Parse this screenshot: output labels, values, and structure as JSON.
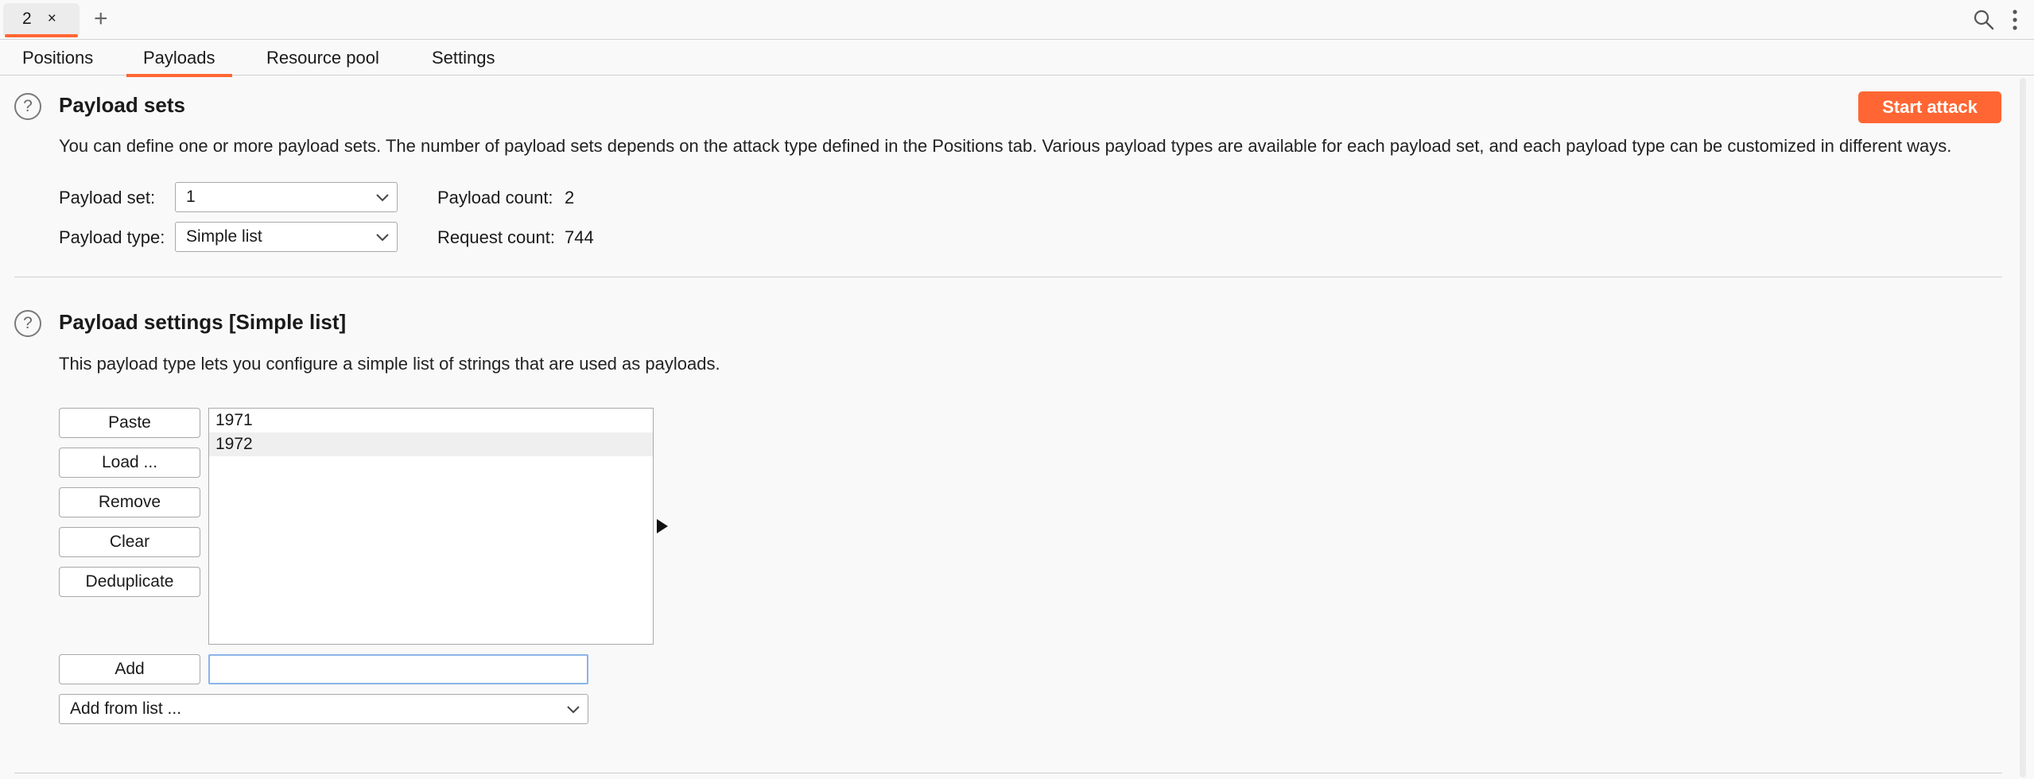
{
  "tab": {
    "label": "2",
    "close": "×",
    "new_tab": "+"
  },
  "subtabs": [
    "Positions",
    "Payloads",
    "Resource pool",
    "Settings"
  ],
  "accent_color": "#ff6633",
  "payload_sets": {
    "title": "Payload sets",
    "help": "?",
    "start_attack": "Start attack",
    "description": "You can define one or more payload sets. The number of payload sets depends on the attack type defined in the Positions tab. Various payload types are available for each payload set, and each payload type can be customized in different ways.",
    "payload_set_label": "Payload set:",
    "payload_set_value": "1",
    "payload_type_label": "Payload type:",
    "payload_type_value": "Simple list",
    "payload_count_label": "Payload count:",
    "payload_count_value": "2",
    "request_count_label": "Request count:",
    "request_count_value": "744"
  },
  "payload_settings": {
    "title": "Payload settings [Simple list]",
    "help": "?",
    "description": "This payload type lets you configure a simple list of strings that are used as payloads.",
    "buttons": {
      "paste": "Paste",
      "load": "Load ...",
      "remove": "Remove",
      "clear": "Clear",
      "deduplicate": "Deduplicate",
      "add": "Add"
    },
    "items": [
      "1971",
      "1972"
    ],
    "add_input_value": "",
    "add_from_list": "Add from list ..."
  },
  "icons": {
    "search": "search-icon",
    "kebab": "kebab-menu-icon",
    "chevron": "chevron-down-icon",
    "arrow": "play-arrow-icon",
    "help": "help-circle-icon"
  }
}
